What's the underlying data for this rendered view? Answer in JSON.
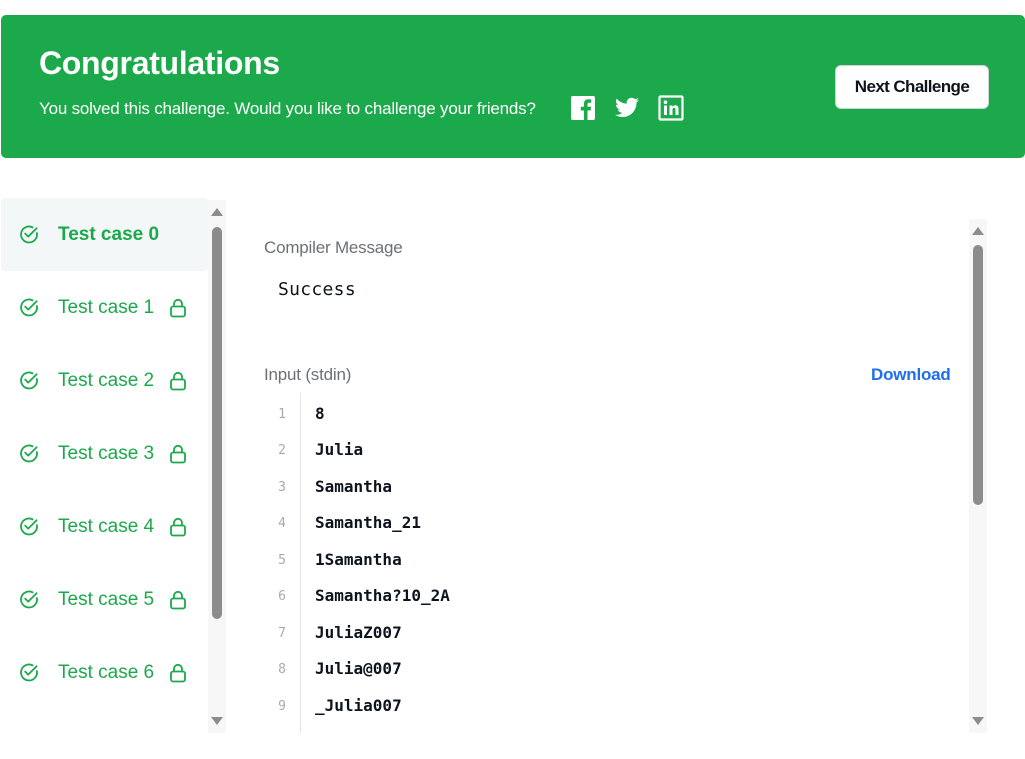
{
  "banner": {
    "title": "Congratulations",
    "subtitle": "You solved this challenge. Would you like to challenge your friends?",
    "share_icons": [
      "facebook-icon",
      "twitter-icon",
      "linkedin-icon"
    ],
    "next_button": "Next Challenge",
    "color": "#1ba94c"
  },
  "test_cases": {
    "items": [
      {
        "label": "Test case 0",
        "passed": true,
        "locked": false,
        "active": true
      },
      {
        "label": "Test case 1",
        "passed": true,
        "locked": true,
        "active": false
      },
      {
        "label": "Test case 2",
        "passed": true,
        "locked": true,
        "active": false
      },
      {
        "label": "Test case 3",
        "passed": true,
        "locked": true,
        "active": false
      },
      {
        "label": "Test case 4",
        "passed": true,
        "locked": true,
        "active": false
      },
      {
        "label": "Test case 5",
        "passed": true,
        "locked": true,
        "active": false
      },
      {
        "label": "Test case 6",
        "passed": true,
        "locked": true,
        "active": false
      }
    ],
    "icons": {
      "status": "check-circle-icon",
      "locked": "lock-icon"
    }
  },
  "details": {
    "compiler_label": "Compiler Message",
    "compiler_message": "Success",
    "input_label": "Input (stdin)",
    "download_label": "Download",
    "input_lines": [
      {
        "n": "1",
        "text": "8"
      },
      {
        "n": "2",
        "text": "Julia"
      },
      {
        "n": "3",
        "text": "Samantha"
      },
      {
        "n": "4",
        "text": "Samantha_21"
      },
      {
        "n": "5",
        "text": "1Samantha"
      },
      {
        "n": "6",
        "text": "Samantha?10_2A"
      },
      {
        "n": "7",
        "text": "JuliaZ007"
      },
      {
        "n": "8",
        "text": "Julia@007"
      },
      {
        "n": "9",
        "text": "_Julia007"
      }
    ]
  }
}
